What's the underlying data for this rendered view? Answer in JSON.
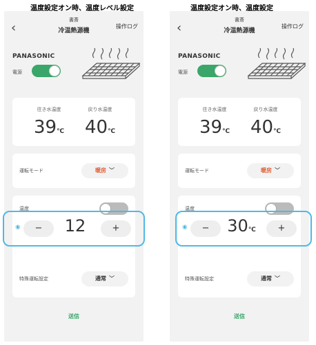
{
  "captions": {
    "left": "温度設定オン時、温度レベル設定",
    "right": "温度設定オン時、温度設定"
  },
  "header": {
    "back_icon": "‹",
    "room": "書斎",
    "device": "冷温熱源機",
    "log": "操作ログ"
  },
  "device": {
    "brand": "PANASONIC",
    "power_label": "電源",
    "power_on": true
  },
  "temps": {
    "outgoing_label": "往き水温度",
    "outgoing_value": "39",
    "return_label": "戻り水温度",
    "return_value": "40",
    "unit": "℃"
  },
  "mode": {
    "label": "運転モード",
    "value": "暖房",
    "value_color": "#e0603a"
  },
  "temperature": {
    "label": "温度",
    "enabled": false,
    "marker": "⑥",
    "minus": "−",
    "plus": "+",
    "left_value": "12",
    "right_value": "30",
    "right_unit": "℃"
  },
  "special": {
    "label": "特殊運転設定",
    "value": "通常"
  },
  "footer": {
    "send": "送信"
  },
  "colors": {
    "accent": "#3aa66a",
    "highlight": "#4fb8e6"
  }
}
